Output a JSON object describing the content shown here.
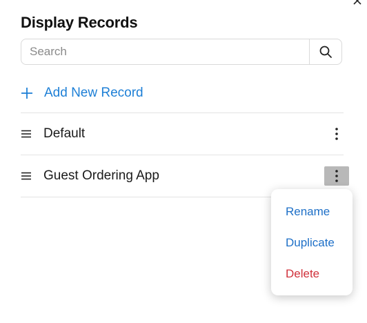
{
  "header": {
    "title": "Display Records",
    "close_icon": "close-icon"
  },
  "search": {
    "placeholder": "Search",
    "value": "",
    "icon": "search-icon"
  },
  "add_record": {
    "label": "Add New Record",
    "icon": "plus-icon"
  },
  "records": [
    {
      "name": "Default",
      "menu_open": false
    },
    {
      "name": "Guest Ordering App",
      "menu_open": true
    }
  ],
  "context_menu": {
    "items": [
      {
        "label": "Rename",
        "color": "#1d6fc7"
      },
      {
        "label": "Duplicate",
        "color": "#1d6fc7"
      },
      {
        "label": "Delete",
        "color": "#d0303a"
      }
    ]
  },
  "colors": {
    "accent": "#1d7fd6",
    "danger": "#d0303a",
    "active_kebab_bg": "#b8b8b8"
  }
}
